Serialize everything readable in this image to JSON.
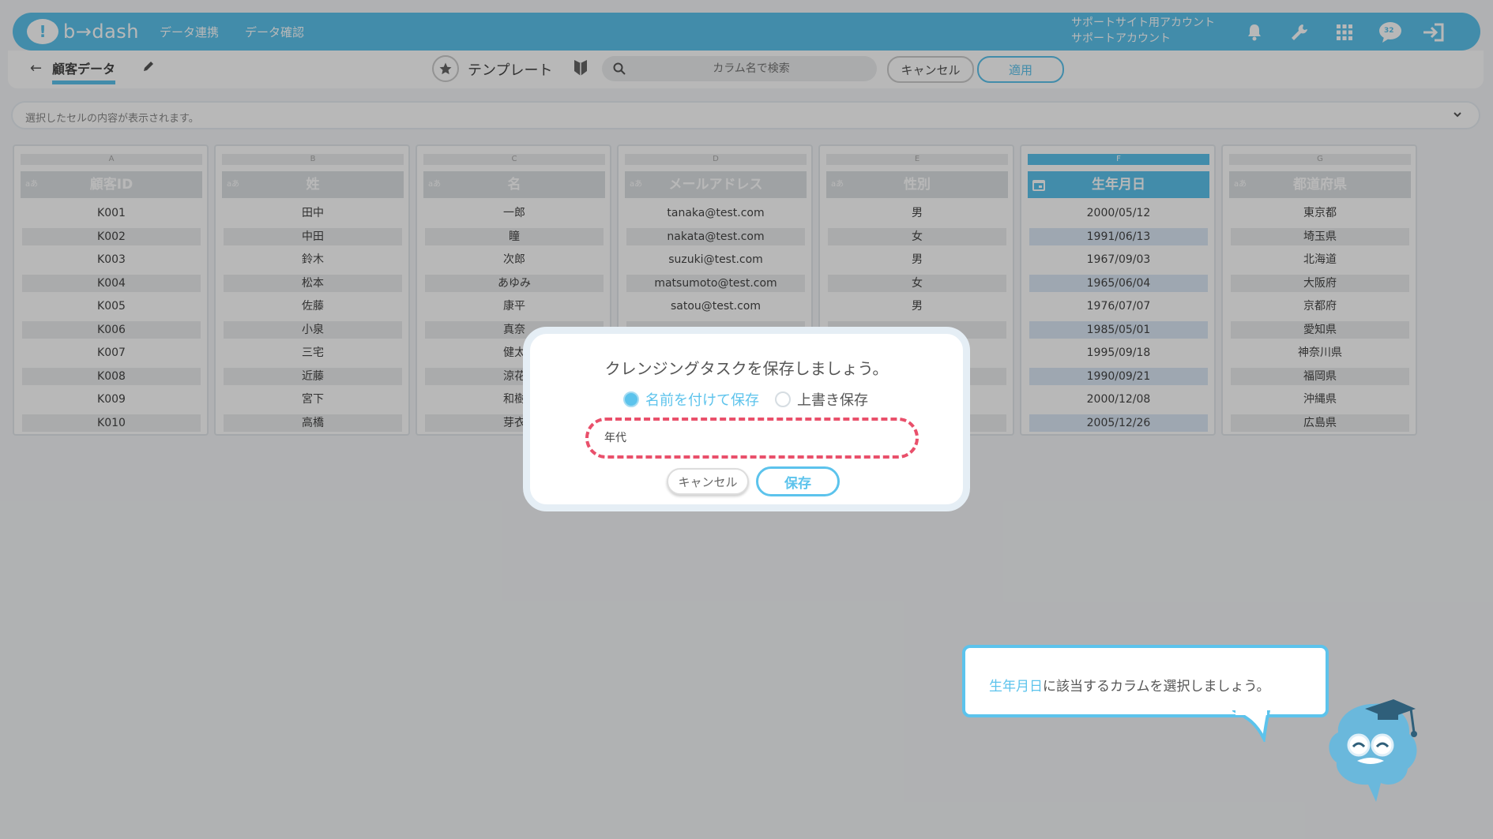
{
  "header": {
    "logo_text": "b→dash",
    "nav": [
      "データ連携",
      "データ確認"
    ],
    "account_line1": "サポートサイト用アカウント",
    "account_line2": "サポートアカウント",
    "icons": [
      "bell-icon",
      "wrench-icon",
      "grid-icon",
      "chat-badge-icon",
      "logout-icon"
    ],
    "chat_badge": "32"
  },
  "toolbar": {
    "back_icon": "arrow-left-icon",
    "doc_title": "顧客データ",
    "template_label": "テンプレート",
    "search_placeholder": "カラム名で検索",
    "cancel_label": "キャンセル",
    "apply_label": "適用"
  },
  "cellbar": {
    "placeholder": "選択したセルの内容が表示されます。"
  },
  "columns": [
    {
      "letter": "A",
      "type": "aあ",
      "name": "顧客ID",
      "cells": [
        "K001",
        "K002",
        "K003",
        "K004",
        "K005",
        "K006",
        "K007",
        "K008",
        "K009",
        "K010"
      ]
    },
    {
      "letter": "B",
      "type": "aあ",
      "name": "姓",
      "cells": [
        "田中",
        "中田",
        "鈴木",
        "松本",
        "佐藤",
        "小泉",
        "三宅",
        "近藤",
        "宮下",
        "高橋"
      ]
    },
    {
      "letter": "C",
      "type": "aあ",
      "name": "名",
      "cells": [
        "一郎",
        "瞳",
        "次郎",
        "あゆみ",
        "康平",
        "真奈",
        "健太",
        "涼花",
        "和樹",
        "芽衣"
      ]
    },
    {
      "letter": "D",
      "type": "aあ",
      "name": "メールアドレス",
      "cells": [
        "tanaka@test.com",
        "nakata@test.com",
        "suzuki@test.com",
        "matsumoto@test.com",
        "satou@test.com",
        "",
        "",
        "",
        "",
        ""
      ]
    },
    {
      "letter": "E",
      "type": "aあ",
      "name": "性別",
      "cells": [
        "男",
        "女",
        "男",
        "女",
        "男",
        "",
        "",
        "",
        "",
        ""
      ]
    },
    {
      "letter": "F",
      "type": "date",
      "name": "生年月日",
      "cells": [
        "2000/05/12",
        "1991/06/13",
        "1967/09/03",
        "1965/06/04",
        "1976/07/07",
        "1985/05/01",
        "1995/09/18",
        "1990/09/21",
        "2000/12/08",
        "2005/12/26"
      ]
    },
    {
      "letter": "G",
      "type": "aあ",
      "name": "都道府県",
      "cells": [
        "東京都",
        "埼玉県",
        "北海道",
        "大阪府",
        "京都府",
        "愛知県",
        "神奈川県",
        "福岡県",
        "沖縄県",
        "広島県"
      ]
    }
  ],
  "modal": {
    "title": "クレンジングタスクを保存しましょう。",
    "option_named": "名前を付けて保存",
    "option_overwrite": "上書き保存",
    "name_value": "年代",
    "cancel_label": "キャンセル",
    "save_label": "保存"
  },
  "hint": {
    "highlight": "生年月日",
    "text": "に該当するカラムを選択しましょう。"
  },
  "colors": {
    "accent": "#5cc3ec",
    "danger_dash": "#e9506b"
  }
}
